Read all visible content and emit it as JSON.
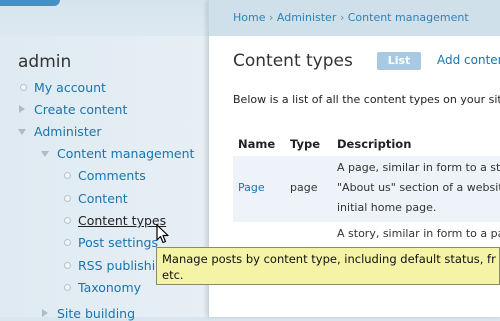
{
  "sidebar": {
    "title": "admin",
    "items": [
      {
        "label": "My account"
      },
      {
        "label": "Create content"
      },
      {
        "label": "Administer"
      },
      {
        "label": "Content management"
      },
      {
        "label": "Comments"
      },
      {
        "label": "Content"
      },
      {
        "label": "Content types"
      },
      {
        "label": "Post settings"
      },
      {
        "label": "RSS publishing"
      },
      {
        "label": "Taxonomy"
      },
      {
        "label": "Site building"
      }
    ]
  },
  "breadcrumb": {
    "home": "Home",
    "administer": "Administer",
    "current": "Content management",
    "separator": "›"
  },
  "page": {
    "title": "Content types",
    "tab_list": "List",
    "tab_add": "Add conten",
    "intro": "Below is a list of all the content types on your site."
  },
  "table": {
    "headers": [
      "Name",
      "Type",
      "Description"
    ],
    "rows": [
      {
        "name": "Page",
        "type": "page",
        "description_lines": [
          "A page, similar in form to a sto",
          "\"About us\" section of a website",
          "initial home page."
        ]
      },
      {
        "name": "",
        "type": "",
        "description_lines": [
          "A story, similar in form to a pa"
        ]
      }
    ]
  },
  "tooltip": {
    "line1": "Manage posts by content type, including default status, fr",
    "line2": "etc."
  },
  "colors": {
    "link": "#1a74ae",
    "tooltip_bg": "#f5f3a6",
    "row_highlight": "#edf3f8",
    "tab_active": "#a9c9e2"
  }
}
